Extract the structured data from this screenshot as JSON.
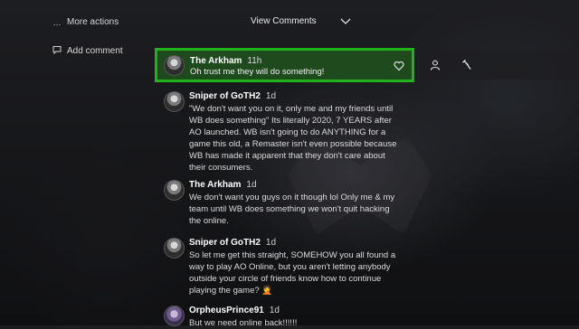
{
  "sidebar": {
    "more_actions": {
      "icon": "ellipsis-icon",
      "label": "More actions"
    },
    "add_comment": {
      "icon": "comment-icon",
      "label": "Add comment"
    }
  },
  "header": {
    "view_comments_label": "View Comments",
    "chevron_icon": "chevron-down-icon"
  },
  "selected_comment": {
    "author": "The Arkham",
    "time": "11h",
    "text": "Oh trust me they will do something!",
    "actions": [
      "heart-icon",
      "person-icon",
      "hammer-icon"
    ]
  },
  "comments": [
    {
      "author": "Sniper of GoTH2",
      "time": "1d",
      "text": "\"We don't want you on it, only me and my friends until WB does something\" Its literally 2020, 7 YEARS after AO launched. WB isn't going to do ANYTHING for a game this old, a Remaster isn't even possible because WB has made it apparent that they don't care about their consumers."
    },
    {
      "author": "The Arkham",
      "time": "1d",
      "text": "We don't want you guys on it though lol Only me & my team until WB does something we won't quit hacking the online."
    },
    {
      "author": "Sniper of GoTH2",
      "time": "1d",
      "text": "So let me get this straight, SOMEHOW you all found a way to play AO Online, but you aren't letting anybody outside your circle of friends know how to continue playing the game? 🤦"
    },
    {
      "author": "OrpheusPrince91",
      "time": "1d",
      "text": "But we need online back!!!!!!"
    }
  ]
}
